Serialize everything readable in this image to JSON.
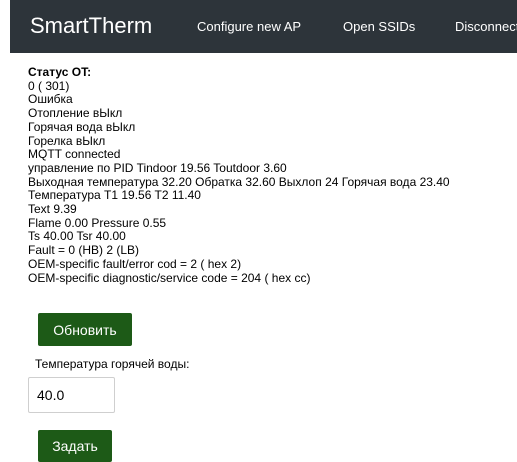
{
  "navbar": {
    "brand": "SmartTherm",
    "links": [
      "Configure new AP",
      "Open SSIDs",
      "Disconnect"
    ]
  },
  "status": {
    "title": "Статус OT:",
    "lines": [
      "0 ( 301)",
      "Ошибка",
      "Отопление вЫкл",
      "Горячая вода вЫкл",
      "Горелка вЫкл",
      "MQTT connected",
      "управление по PID Tindoor 19.56 Toutdoor 3.60",
      "Выходная температура 32.20 Обратка 32.60 Выхлоп 24 Горячая вода 23.40",
      "Температура T1 19.56 T2 11.40",
      "Text 9.39",
      "Flame 0.00 Pressure 0.55",
      "Ts 40.00 Tsr 40.00",
      "Fault = 0 (HB) 2 (LB)",
      "OEM-specific fault/error cod = 2 ( hex 2)",
      "OEM-specific diagnostic/service code = 204 ( hex cc)"
    ]
  },
  "refresh_button": "Обновить",
  "hot_water": {
    "label": "Температура горячей воды:",
    "value": "40.0"
  },
  "set_button": "Задать"
}
